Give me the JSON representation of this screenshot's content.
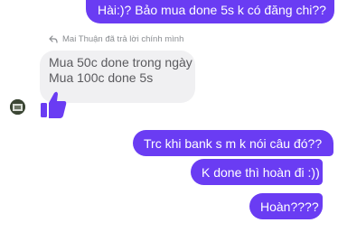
{
  "messages": {
    "top": "Hài:)? Bảo mua done 5s k có đăng chi??",
    "reply_note": "Mai Thuận đã trả lời chính mình",
    "quoted_line_1": "Mua 50c done trong ngày",
    "quoted_line_2": "Mua 100c done 5s",
    "out_1": "Trc khi bank s m k nói câu đó??",
    "out_2": "K done thì hoàn đi :))",
    "out_3": "Hoàn????"
  },
  "icons": {
    "reply": "reply-arrow-icon",
    "like": "thumbs-up-icon",
    "avatar": "user-avatar"
  },
  "colors": {
    "sent_bubble": "#6a3cf3",
    "received_bubble": "#f0f0f2",
    "like_icon": "#6a3cf3"
  }
}
